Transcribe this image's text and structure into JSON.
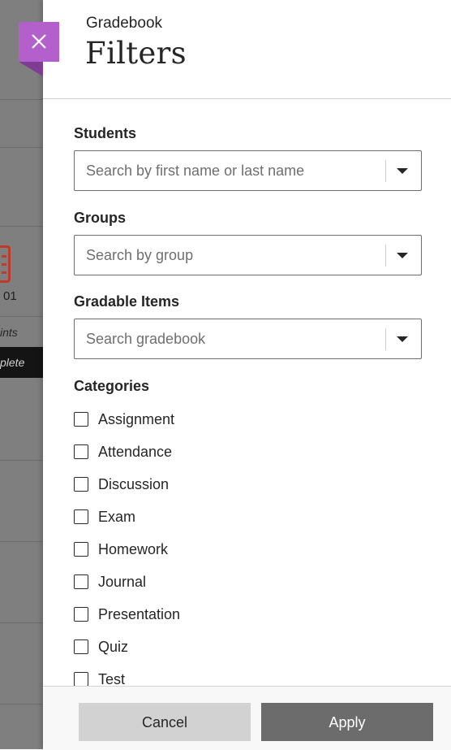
{
  "background": {
    "number": "01",
    "points_text": "ints",
    "complete_text": "plete"
  },
  "header": {
    "subtitle": "Gradebook",
    "title": "Filters",
    "close_icon": "close-icon",
    "accent_color": "#b35fcc"
  },
  "fields": [
    {
      "label": "Students",
      "placeholder": "Search by first name or last name"
    },
    {
      "label": "Groups",
      "placeholder": "Search by group"
    },
    {
      "label": "Gradable Items",
      "placeholder": "Search gradebook"
    }
  ],
  "categories": {
    "label": "Categories",
    "items": [
      {
        "label": "Assignment",
        "checked": false
      },
      {
        "label": "Attendance",
        "checked": false
      },
      {
        "label": "Discussion",
        "checked": false
      },
      {
        "label": "Exam",
        "checked": false
      },
      {
        "label": "Homework",
        "checked": false
      },
      {
        "label": "Journal",
        "checked": false
      },
      {
        "label": "Presentation",
        "checked": false
      },
      {
        "label": "Quiz",
        "checked": false
      },
      {
        "label": "Test",
        "checked": false
      }
    ]
  },
  "footer": {
    "cancel_label": "Cancel",
    "apply_label": "Apply"
  }
}
